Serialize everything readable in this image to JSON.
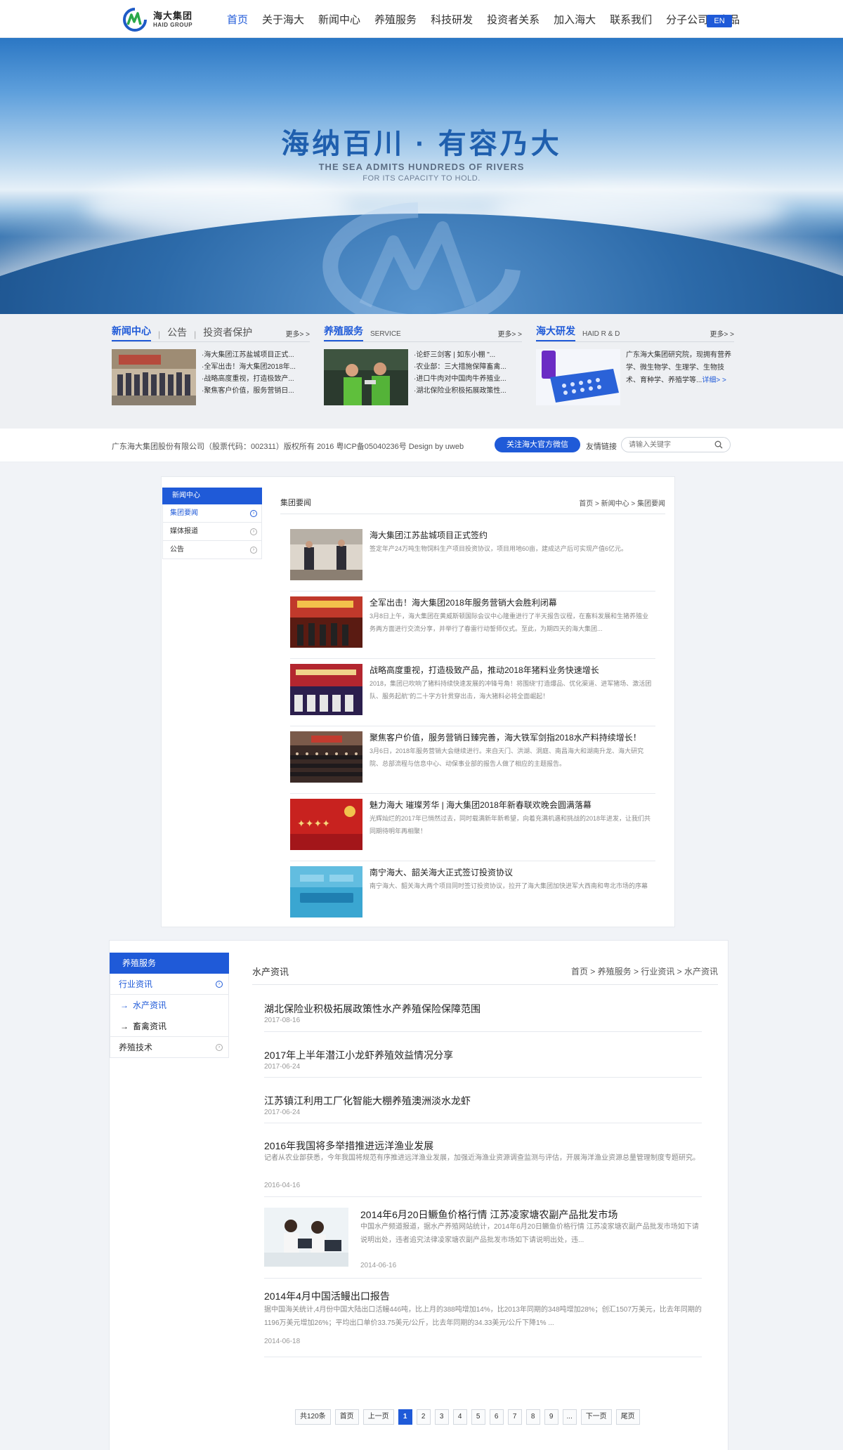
{
  "header": {
    "logo_cn": "海大集团",
    "logo_en": "HAID GROUP",
    "nav": [
      "首页",
      "关于海大",
      "新闻中心",
      "养殖服务",
      "科技研发",
      "投资者关系",
      "加入海大",
      "联系我们",
      "分子公司及产品"
    ],
    "lang": "EN"
  },
  "banner": {
    "slogan_cn": "海纳百川 · 有容乃大",
    "slogan_en1": "THE SEA ADMITS HUNDREDS OF RIVERS",
    "slogan_en2": "FOR ITS CAPACITY TO HOLD."
  },
  "strip": {
    "news": {
      "tab1": "新闻中心",
      "tab2": "公告",
      "tab3": "投资者保护",
      "more": "更多> >",
      "items": [
        "·海大集团江苏盐城项目正式...",
        "·全军出击！海大集团2018年...",
        "·战略高度重视，打造极致产...",
        "·聚焦客户价值，服务营销日..."
      ]
    },
    "service": {
      "tab": "养殖服务",
      "sub": "SERVICE",
      "more": "更多> >",
      "items": [
        "·论虾三剑客 | 如东小棚 \"...",
        "·农业部：三大措施保障畜禽...",
        "·进口牛肉对中国肉牛养殖业...",
        "·湖北保险业积极拓展政策性..."
      ]
    },
    "rd": {
      "tab": "海大研发",
      "sub": "HAID R & D",
      "more": "更多> >",
      "text": "广东海大集团研究院，现拥有营养学、微生物学、生理学、生物技术、育种学、养殖学等...",
      "detail": "详细> >"
    }
  },
  "footer": {
    "copyright": "广东海大集团股份有限公司（股票代码：002311）版权所有 2016 粤ICP备05040236号 Design by uweb",
    "wechat": "关注海大官方微信",
    "links": "友情链接",
    "search_placeholder": "请输入关键字"
  },
  "panel1": {
    "side_title": "新闻中心",
    "side_items": [
      "集团要闻",
      "媒体报道",
      "公告"
    ],
    "title": "集团要闻",
    "crumb": "首页 > 新闻中心 > 集团要闻",
    "articles": [
      {
        "title": "海大集团江苏盐城项目正式签约",
        "desc": "签定年产24万吨生物饲料生产项目投资协议，项目用地60亩，建成达产后可实现产值6亿元。"
      },
      {
        "title": "全军出击！海大集团2018年服务营销大会胜利闭幕",
        "desc": "3月8日上午，海大集团在黄威斯顿国际会议中心隆重进行了半天报告议程，在畜料发展和生猪养殖业务两方面进行交流分享，并举行了春雷行动誓师仪式。至此，为期四天的海大集团..."
      },
      {
        "title": "战略高度重视，打造极致产品，推动2018年猪料业务快速增长",
        "desc": "2018，集团已吹响了猪料持续快速发展的冲锋号角！将围绕\"打造爆品、优化渠道、进军猪场、激活团队、服务起航\"的二十字方针贯穿出击，海大猪料必将全面崛起！"
      },
      {
        "title": "聚焦客户价值，服务营销日臻完善，海大铁军剑指2018水产料持续增长！",
        "desc": "3月6日，2018年服务营销大会继续进行。来自天门、洪湖、洞庭、南昌海大和湖南升龙、海大研究院、总部流程与信息中心、动保事业部的报告人做了相应的主题报告。"
      },
      {
        "title": "魅力海大 璀璨芳华 | 海大集团2018年新春联欢晚会圆满落幕",
        "desc": "光辉灿烂的2017年已悄然过去，同时载满新年新希望，向着充满机遇和挑战的2018年进发，让我们共同期待明年再相聚！"
      },
      {
        "title": "南宁海大、韶关海大正式签订投资协议",
        "desc": "南宁海大、韶关海大两个项目同时签订投资协议，拉开了海大集团加快进军大西南和粤北市场的序幕"
      }
    ]
  },
  "panel2": {
    "side_title": "养殖服务",
    "side_active": "行业资讯",
    "side_subs": [
      "水产资讯",
      "畜禽资讯"
    ],
    "side_last": "养殖技术",
    "title": "水产资讯",
    "crumb": "首页 > 养殖服务 > 行业资讯 > 水产资讯",
    "articles": [
      {
        "title": "湖北保险业积极拓展政策性水产养殖保险保障范围",
        "date": "2017-08-16"
      },
      {
        "title": "2017年上半年潜江小龙虾养殖效益情况分享",
        "date": "2017-06-24"
      },
      {
        "title": "江苏镇江利用工厂化智能大棚养殖澳洲淡水龙虾",
        "date": "2017-06-24"
      },
      {
        "title": "2016年我国将多举措推进远洋渔业发展",
        "desc": "记者从农业部获悉，今年我国将规范有序推进远洋渔业发展，加强近海渔业资源调查监测与评估，开展海洋渔业资源总量管理制度专题研究。",
        "date": "2016-04-16"
      },
      {
        "title": "2014年6月20日鳜鱼价格行情 江苏凌家塘农副产品批发市场",
        "desc": "中国水产频道报道，据水产养殖网站统计，2014年6月20日鳜鱼价格行情 江苏凌家塘农副产品批发市场如下请说明出处，违者追究法律凌家塘农副产品批发市场如下请说明出处，违...",
        "date": "2014-06-16"
      },
      {
        "title": "2014年4月中国活鳗出口报告",
        "desc": "据中国海关统计,4月份中国大陆出口活鳗446吨，比上月的388吨增加14%，比2013年同期的348吨增加28%；创汇1507万美元，比去年同期的1196万美元增加26%；平均出口单价33.75美元/公斤，比去年同期的34.33美元/公斤下降1% ...",
        "date": "2014-06-18"
      }
    ],
    "pager": {
      "total": "共120条",
      "first": "首页",
      "prev": "上一页",
      "pages": [
        "1",
        "2",
        "3",
        "4",
        "5",
        "6",
        "7",
        "8",
        "9"
      ],
      "ellipsis": "...",
      "next": "下一页",
      "last": "尾页"
    }
  }
}
